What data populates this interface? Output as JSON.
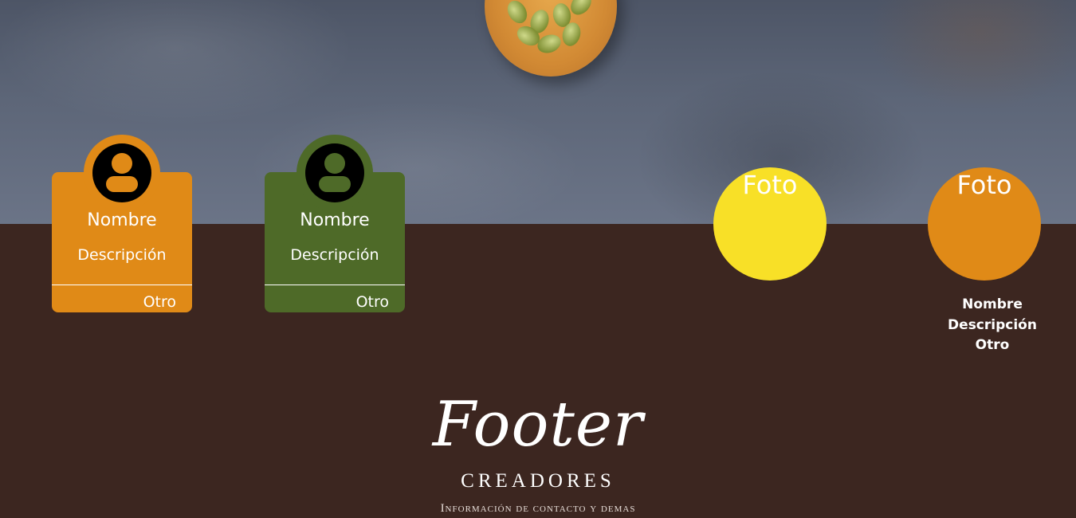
{
  "hero": {
    "image": "concrete-background-with-cardamom-spoon"
  },
  "team": [
    {
      "name": "Nombre",
      "description": "Descripción",
      "other": "Otro",
      "color": "#e08a17",
      "icon": "user-icon"
    },
    {
      "name": "Nombre",
      "description": "Descripción",
      "other": "Otro",
      "color": "#4e6a28",
      "icon": "user-icon"
    }
  ],
  "photos": [
    {
      "label": "Foto",
      "color": "#f8e027"
    },
    {
      "label": "Foto",
      "color": "#e08a17",
      "name": "Nombre",
      "description": "Descripción",
      "other": "Otro"
    }
  ],
  "footer": {
    "title": "Footer",
    "subtitle": "CREADORES",
    "info": "Información de contacto y demas"
  },
  "colors": {
    "background": "#3c2620",
    "accent_orange": "#e08a17",
    "accent_green": "#4e6a28",
    "accent_yellow": "#f8e027"
  }
}
